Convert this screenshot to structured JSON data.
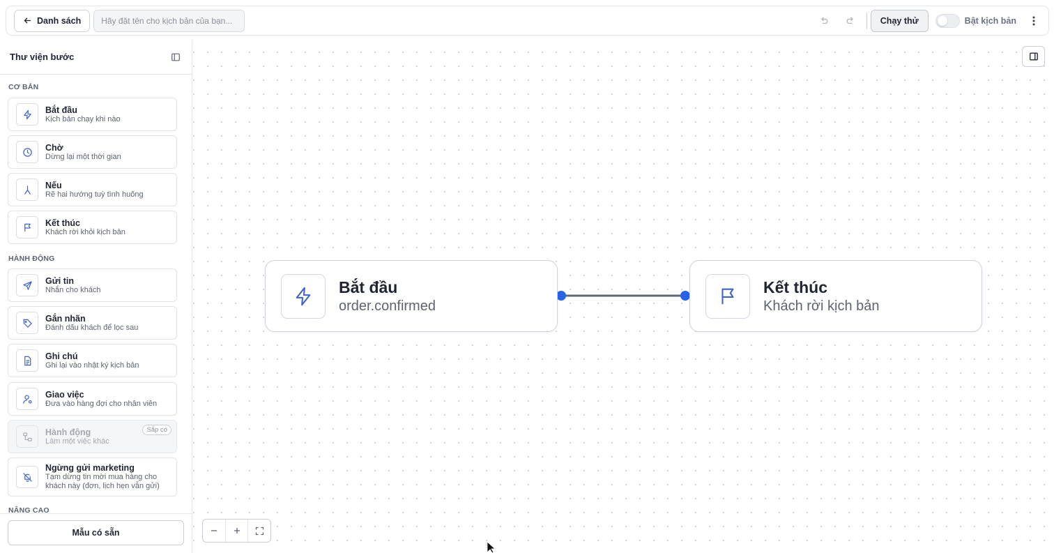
{
  "header": {
    "back_label": "Danh sách",
    "name_placeholder": "Hãy đặt tên cho kịch bản của bạn...",
    "run_label": "Chạy thử",
    "toggle_label": "Bật kịch bản"
  },
  "sidebar": {
    "title": "Thư viện bước",
    "sections": {
      "basic": "CƠ BẢN",
      "actions": "HÀNH ĐỘNG",
      "advanced": "NÂNG CAO"
    },
    "items": [
      {
        "title": "Bắt đầu",
        "desc": "Kịch bản chạy khi nào",
        "icon": "lightning-icon"
      },
      {
        "title": "Chờ",
        "desc": "Dừng lại một thời gian",
        "icon": "clock-icon"
      },
      {
        "title": "Nếu",
        "desc": "Rẽ hai hướng tuỳ tình huống",
        "icon": "branch-icon"
      },
      {
        "title": "Kết thúc",
        "desc": "Khách rời khỏi kịch bản",
        "icon": "flag-icon"
      },
      {
        "title": "Gửi tin",
        "desc": "Nhắn cho khách",
        "icon": "send-icon"
      },
      {
        "title": "Gắn nhãn",
        "desc": "Đánh dấu khách để lọc sau",
        "icon": "tag-icon"
      },
      {
        "title": "Ghi chú",
        "desc": "Ghi lại vào nhật ký kịch bản",
        "icon": "note-icon"
      },
      {
        "title": "Giao việc",
        "desc": "Đưa vào hàng đợi cho nhân viên",
        "icon": "assign-user-icon"
      },
      {
        "title": "Hành động",
        "desc": "Làm một việc khác",
        "icon": "workflow-icon",
        "badge": "Sắp có"
      },
      {
        "title": "Ngừng gửi marketing",
        "desc_line1": "Tạm dừng tin mời mua hàng cho",
        "desc_line2": "khách này (đơn, lịch hẹn vẫn gửi)",
        "icon": "bell-off-icon"
      }
    ],
    "templates_label": "Mẫu có sẵn"
  },
  "canvas": {
    "nodes": [
      {
        "title": "Bắt đầu",
        "subtitle": "order.confirmed",
        "icon": "lightning-icon"
      },
      {
        "title": "Kết thúc",
        "subtitle": "Khách rời kịch bản",
        "icon": "flag-icon"
      }
    ],
    "edge_color": "#5f6673",
    "handle_color": "#2563eb"
  },
  "colors": {
    "accent": "#3f63c9",
    "border": "#dfe2e7"
  }
}
